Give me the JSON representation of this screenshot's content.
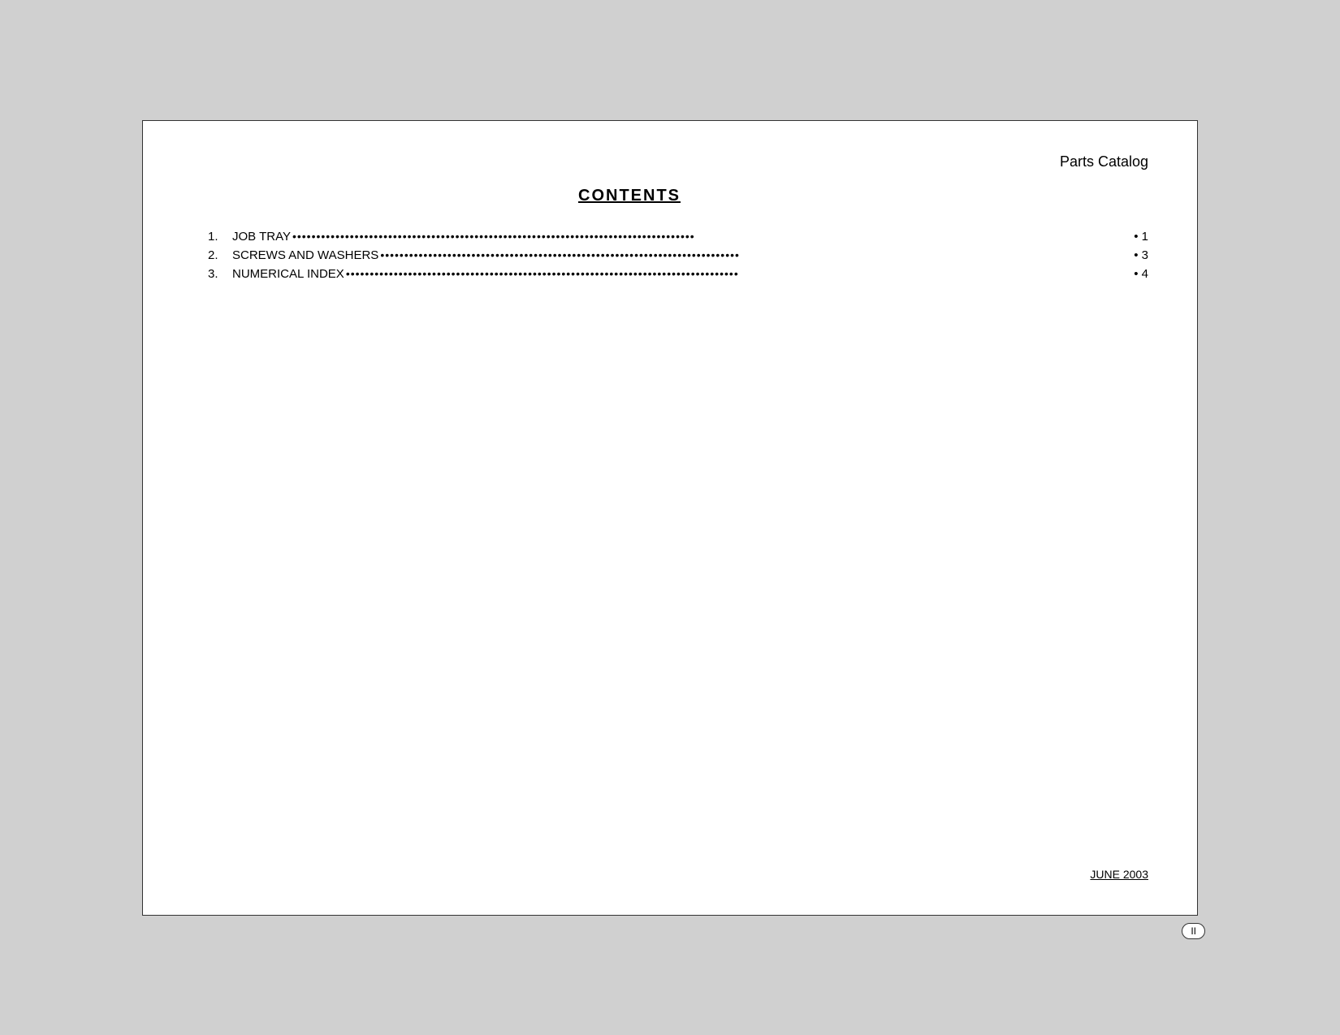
{
  "header": {
    "parts_catalog": "Parts Catalog"
  },
  "title": {
    "label": "CONTENTS"
  },
  "toc": {
    "items": [
      {
        "number": "1.",
        "label": "JOB TRAY",
        "dots": "••••••••••••••••••••••••••••••••••••••••••••••••••••••••••••••••••••••••••••••••••••",
        "page": "• 1"
      },
      {
        "number": "2.",
        "label": "SCREWS AND WASHERS",
        "dots": "•••••••••••••••••••••••••••••••••••••••••••••••••••••••••••••••••••••••••••",
        "page": "• 3"
      },
      {
        "number": "3.",
        "label": "NUMERICAL INDEX",
        "dots": "••••••••••••••••••••••••••••••••••••••••••••••••••••••••••••••••••••••••••••••••••",
        "page": "• 4"
      }
    ]
  },
  "footer": {
    "date": "JUNE 2003"
  },
  "page_number": {
    "value": "II"
  }
}
